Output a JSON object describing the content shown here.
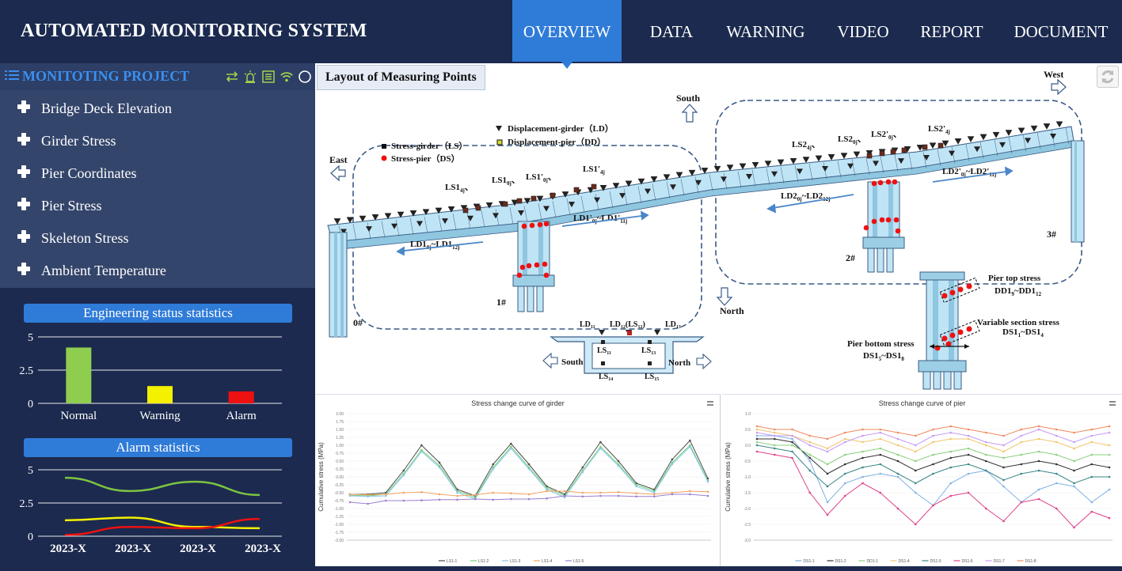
{
  "app": {
    "title": "AUTOMATED MONITORING SYSTEM"
  },
  "nav": {
    "items": [
      {
        "label": "OVERVIEW",
        "active": true
      },
      {
        "label": "DATA",
        "active": false
      },
      {
        "label": "WARNING",
        "active": false
      },
      {
        "label": "VIDEO",
        "active": false
      },
      {
        "label": "REPORT",
        "active": false
      },
      {
        "label": "DOCUMENT",
        "active": false
      }
    ]
  },
  "sidebar": {
    "project_title": "MONITOTING PROJECT",
    "tool_icons": [
      "swap-icon",
      "alarm-light-icon",
      "list-doc-icon",
      "wifi-icon",
      "circle-status-icon"
    ],
    "menu": [
      {
        "label": "Bridge Deck Elevation",
        "icon": "plus-icon"
      },
      {
        "label": "Girder Stress",
        "icon": "plus-icon"
      },
      {
        "label": "Pier Coordinates",
        "icon": "plus-icon"
      },
      {
        "label": "Pier Stress",
        "icon": "plus-icon"
      },
      {
        "label": "Skeleton Stress",
        "icon": "plus-icon"
      },
      {
        "label": "Ambient Temperature",
        "icon": "plus-icon"
      }
    ]
  },
  "engineering_status": {
    "title": "Engineering status statistics",
    "chart_data": {
      "type": "bar",
      "categories": [
        "Normal",
        "Warning",
        "Alarm"
      ],
      "values": [
        4.2,
        1.3,
        0.9
      ],
      "colors": [
        "#8fcd4f",
        "#f3f000",
        "#ee1111"
      ],
      "yticks": [
        "0",
        "2.5",
        "5"
      ],
      "ylim": [
        0,
        5
      ],
      "grid": true
    }
  },
  "alarm_statistics": {
    "title": "Alarm statistics",
    "chart_data": {
      "type": "line",
      "categories": [
        "2023-X",
        "2023-X",
        "2023-X",
        "2023-X"
      ],
      "yticks": [
        "0",
        "2.5",
        "5"
      ],
      "ylim": [
        0,
        5
      ],
      "grid": true,
      "series": [
        {
          "color": "#7cc442",
          "values": [
            4.4,
            3.4,
            4.1,
            3.1
          ]
        },
        {
          "color": "#f3f000",
          "values": [
            1.2,
            1.4,
            0.7,
            0.6
          ]
        },
        {
          "color": "#ee1111",
          "values": [
            0.1,
            0.7,
            0.6,
            1.3
          ]
        }
      ]
    }
  },
  "layout": {
    "title": "Layout of Measuring Points",
    "directions": {
      "south": "South",
      "north": "North",
      "east": "East",
      "west": "West"
    },
    "legend": {
      "stress_girder": "Stress-girder（LS）",
      "stress_pier": "Stress-pier（DS）",
      "disp_girder": "Displacement-girder（LD）",
      "disp_pier": "Displacement-pier（DD）"
    },
    "piers": [
      "0#",
      "1#",
      "2#",
      "3#"
    ],
    "labels": {
      "ls1_4j": "LS1",
      "ls1_0j": "LS1",
      "ls1p_0j": "LS1'",
      "ls1p_4j": "LS1'",
      "ls2_4j": "LS2",
      "ls2_0j": "LS2",
      "ls2p_0j": "LS2'",
      "ls2p_4j": "LS2'",
      "ld1": "LD1",
      "ld1p": "LD1'",
      "ld2": "LD2",
      "ld2p": "LD2'"
    },
    "section": {
      "ld11": "LD",
      "ld12": "LD",
      "ld13": "LD",
      "ls11": "LS",
      "ls13": "LS",
      "ls14": "LS",
      "ls15": "LS",
      "south": "South",
      "north": "North"
    },
    "pier_detail": {
      "top": "Pier top stress",
      "top_range": "DD1",
      "variable": "Variable section stress",
      "variable_range": "DS1",
      "bottom": "Pier bottom stress",
      "bottom_range": "DS1"
    }
  },
  "girder_curve": {
    "title": "Stress change curve of girder",
    "ylabel": "Cumulative stress (MPa)",
    "chart_data": {
      "type": "line",
      "ylim": [
        -2,
        2
      ],
      "yticks": [
        "2.00",
        "1.75",
        "1.50",
        "1.25",
        "1.00",
        "0.75",
        "0.50",
        "0.25",
        "0.00",
        "-0.25",
        "-0.50",
        "-0.75",
        "-1.00",
        "-1.25",
        "-1.50",
        "-1.75",
        "-2.00"
      ],
      "series": [
        {
          "name": "LS1-1",
          "color": "#4a4a4a",
          "values": [
            -0.55,
            -0.55,
            -0.5,
            0.2,
            1.0,
            0.45,
            -0.4,
            -0.6,
            0.4,
            1.05,
            0.4,
            -0.3,
            -0.55,
            0.3,
            1.1,
            0.5,
            -0.2,
            -0.4,
            0.55,
            1.15,
            -0.05
          ]
        },
        {
          "name": "LS1-2",
          "color": "#6fd06f",
          "values": [
            -0.58,
            -0.6,
            -0.55,
            0.1,
            0.85,
            0.35,
            -0.45,
            -0.65,
            0.3,
            0.95,
            0.3,
            -0.35,
            -0.6,
            0.2,
            0.95,
            0.4,
            -0.25,
            -0.45,
            0.45,
            1.0,
            -0.12
          ]
        },
        {
          "name": "LS1-3",
          "color": "#89c7f2",
          "values": [
            -0.6,
            -0.62,
            -0.6,
            0.05,
            0.8,
            0.3,
            -0.5,
            -0.7,
            0.25,
            0.9,
            0.25,
            -0.4,
            -0.65,
            0.15,
            0.9,
            0.35,
            -0.3,
            -0.5,
            0.4,
            0.95,
            -0.15
          ]
        },
        {
          "name": "LS1-4",
          "color": "#f4a460",
          "values": [
            -0.55,
            -0.57,
            -0.55,
            -0.5,
            -0.48,
            -0.55,
            -0.6,
            -0.57,
            -0.5,
            -0.52,
            -0.55,
            -0.45,
            -0.45,
            -0.5,
            -0.5,
            -0.48,
            -0.52,
            -0.55,
            -0.5,
            -0.45,
            -0.47
          ]
        },
        {
          "name": "LS1-5",
          "color": "#9b7fd1",
          "values": [
            -0.8,
            -0.85,
            -0.75,
            -0.75,
            -0.74,
            -0.72,
            -0.72,
            -0.7,
            -0.72,
            -0.7,
            -0.7,
            -0.68,
            -0.6,
            -0.62,
            -0.6,
            -0.6,
            -0.62,
            -0.62,
            -0.55,
            -0.55,
            -0.6
          ]
        }
      ]
    }
  },
  "pier_curve": {
    "title": "Stress change curve of pier",
    "ylabel": "Cumulative stress (MPa)",
    "chart_data": {
      "type": "line",
      "ylim": [
        -3,
        1
      ],
      "yticks": [
        "1.0",
        "0.5",
        "0.0",
        "-0.5",
        "-1.0",
        "-1.5",
        "-2.0",
        "-2.5",
        "-3.0"
      ],
      "series": [
        {
          "name": "DS1-1",
          "color": "#7fb2e5",
          "values": [
            0.3,
            0.3,
            0.2,
            -0.5,
            -1.8,
            -1.2,
            -1.0,
            -0.9,
            -1.0,
            -1.5,
            -1.9,
            -1.2,
            -0.9,
            -0.8,
            -1.3,
            -1.8,
            -1.4,
            -1.2,
            -1.3,
            -1.8,
            -1.4
          ]
        },
        {
          "name": "DS1-2",
          "color": "#333333",
          "values": [
            0.2,
            0.2,
            0.1,
            -0.4,
            -0.9,
            -0.6,
            -0.4,
            -0.3,
            -0.5,
            -0.8,
            -0.6,
            -0.4,
            -0.3,
            -0.5,
            -0.7,
            -0.6,
            -0.5,
            -0.6,
            -0.8,
            -0.6,
            -0.7
          ]
        },
        {
          "name": "DD1-1",
          "color": "#8ad07c",
          "values": [
            0.1,
            0.0,
            0.0,
            -0.3,
            -0.6,
            -0.3,
            -0.2,
            -0.1,
            -0.3,
            -0.5,
            -0.3,
            -0.2,
            -0.1,
            -0.3,
            -0.4,
            -0.3,
            -0.2,
            -0.3,
            -0.5,
            -0.3,
            -0.3
          ]
        },
        {
          "name": "DS1-4",
          "color": "#f2c66d",
          "values": [
            0.5,
            0.4,
            0.3,
            0.1,
            -0.1,
            0.2,
            0.1,
            0.2,
            0.0,
            -0.2,
            0.1,
            0.2,
            0.2,
            0.0,
            -0.2,
            0.1,
            0.2,
            0.1,
            -0.1,
            0.1,
            0.0
          ]
        },
        {
          "name": "DS1-5",
          "color": "#3b8686",
          "values": [
            0.0,
            -0.1,
            -0.2,
            -0.8,
            -1.3,
            -0.9,
            -0.7,
            -0.6,
            -0.9,
            -1.2,
            -0.9,
            -0.7,
            -0.6,
            -0.8,
            -1.1,
            -0.9,
            -0.8,
            -0.9,
            -1.2,
            -1.0,
            -1.0
          ]
        },
        {
          "name": "DS1-6",
          "color": "#e0408a",
          "values": [
            -0.2,
            -0.3,
            -0.4,
            -1.5,
            -2.2,
            -1.6,
            -1.2,
            -1.5,
            -2.0,
            -2.5,
            -1.9,
            -1.6,
            -1.5,
            -2.0,
            -2.4,
            -1.8,
            -1.7,
            -2.0,
            -2.6,
            -2.1,
            -2.3
          ]
        },
        {
          "name": "DS1-7",
          "color": "#c59cf5",
          "values": [
            0.4,
            0.3,
            0.3,
            0.0,
            -0.2,
            0.1,
            0.3,
            0.4,
            0.2,
            0.0,
            0.3,
            0.4,
            0.3,
            0.1,
            0.0,
            0.3,
            0.5,
            0.3,
            0.1,
            0.3,
            0.4
          ]
        },
        {
          "name": "DS1-8",
          "color": "#f08a5d",
          "values": [
            0.6,
            0.5,
            0.5,
            0.3,
            0.2,
            0.4,
            0.5,
            0.5,
            0.4,
            0.3,
            0.5,
            0.6,
            0.5,
            0.4,
            0.3,
            0.5,
            0.6,
            0.5,
            0.4,
            0.5,
            0.6
          ]
        }
      ]
    }
  }
}
